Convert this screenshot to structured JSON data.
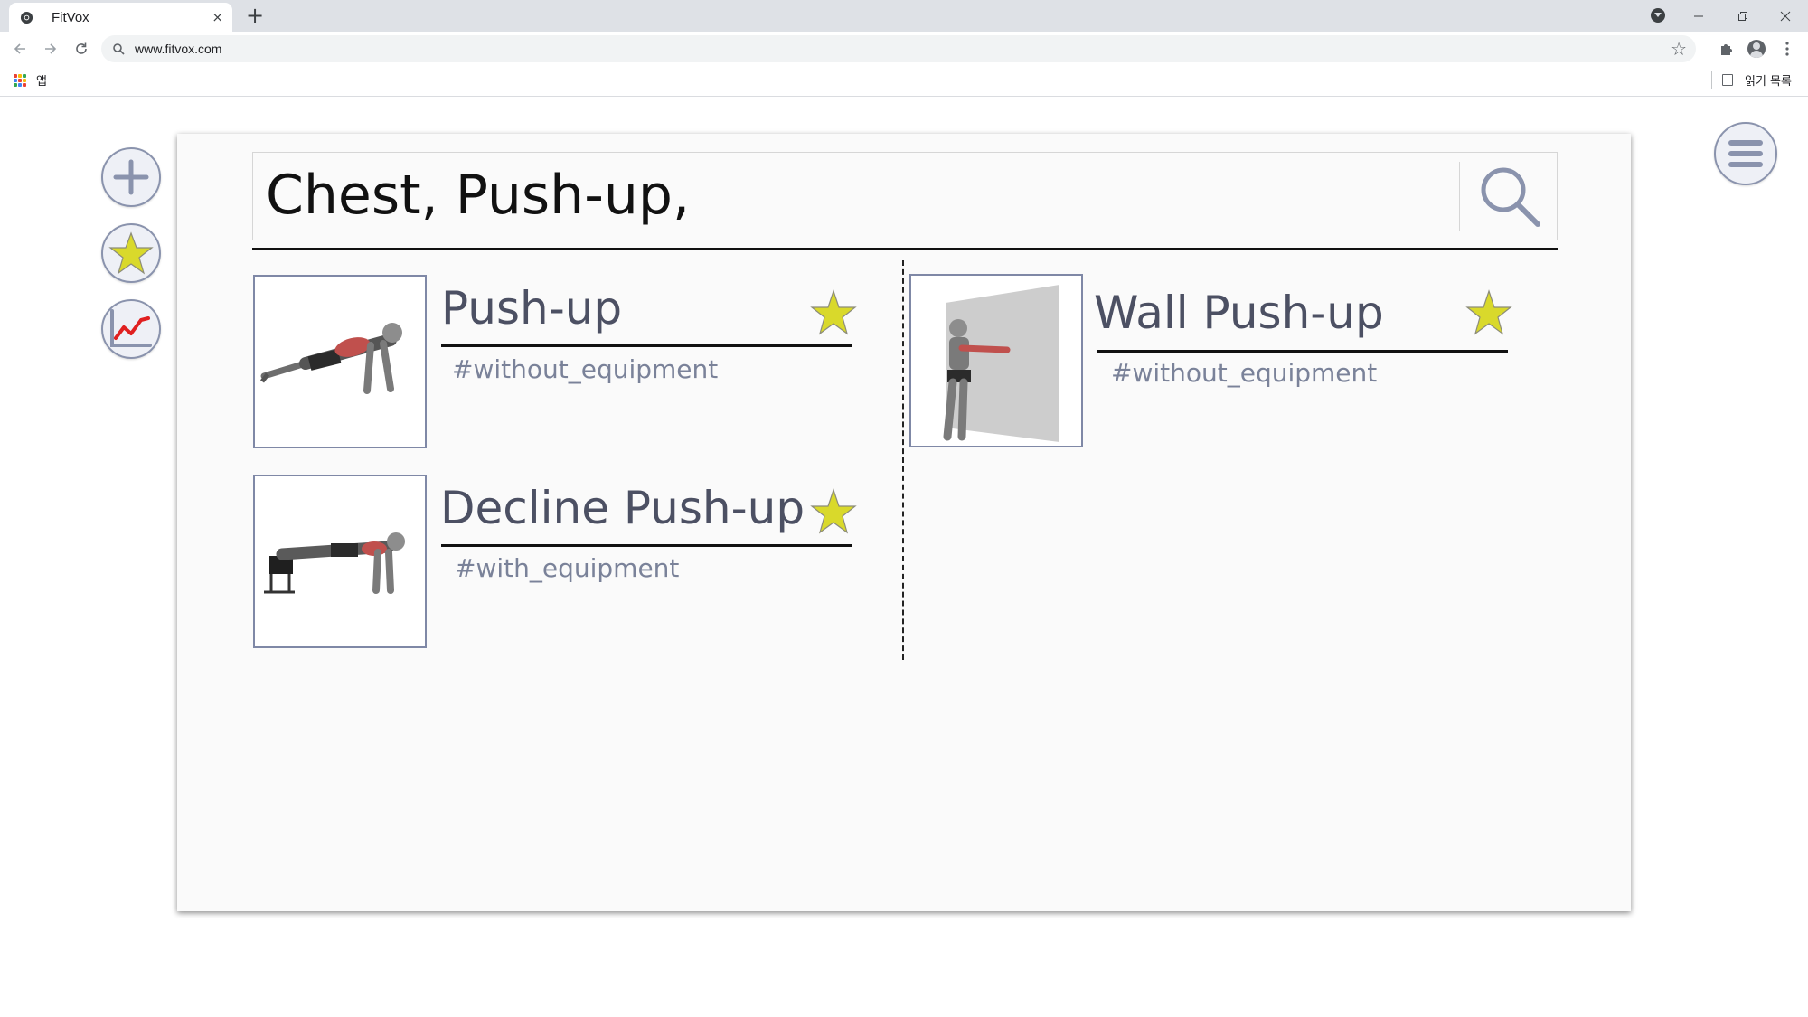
{
  "browser": {
    "tab_title": "FitVox",
    "tab_close_glyph": "×",
    "new_tab_glyph": "+",
    "url": "www.fitvox.com",
    "bookmarks": {
      "apps_label": "앱",
      "reading_list_label": "읽기 목록"
    }
  },
  "sidebar": {
    "add_button_icon": "plus-icon",
    "favorites_button_icon": "star-icon",
    "stats_button_icon": "chart-line-icon"
  },
  "menu_button_icon": "hamburger-icon",
  "search": {
    "query": "Chest, Push-up,"
  },
  "results": [
    {
      "title": "Push-up",
      "tag": "#without_equipment",
      "favorite": true,
      "image_icon": "pushup-figure"
    },
    {
      "title": "Decline Push-up",
      "tag": "#with_equipment",
      "favorite": true,
      "image_icon": "decline-pushup-figure"
    },
    {
      "title": "Wall Push-up",
      "tag": "#without_equipment",
      "favorite": true,
      "image_icon": "wall-pushup-figure"
    }
  ],
  "colors": {
    "star_fill": "#d9d92b",
    "star_stroke": "#8c8c7a",
    "accent_border": "#7f88a6",
    "title_text": "#4c5063",
    "tag_text": "#7a8299"
  }
}
